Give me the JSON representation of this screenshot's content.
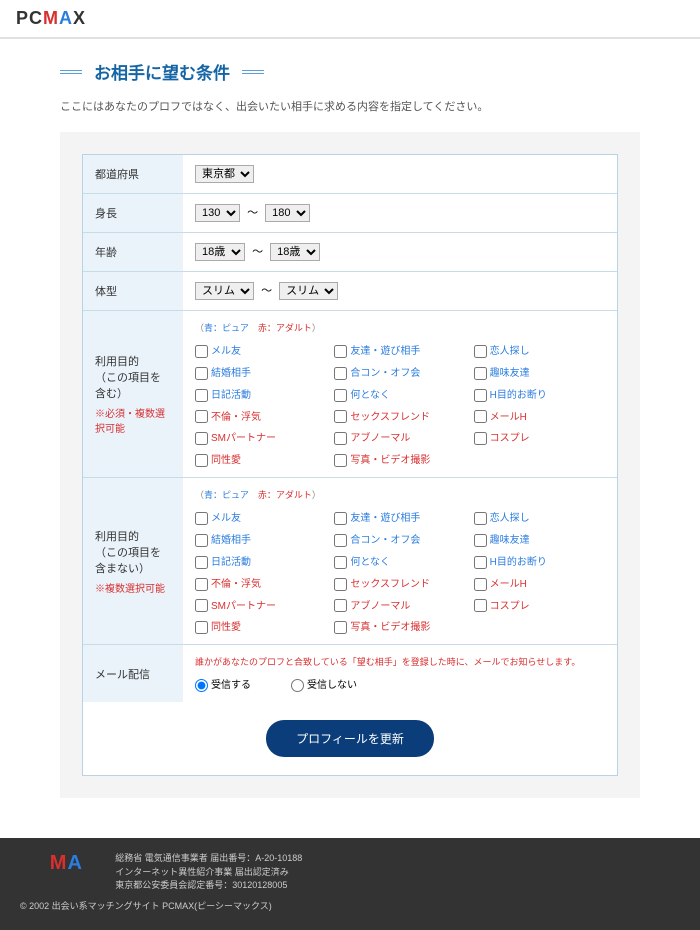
{
  "logo": {
    "p": "P",
    "c": "C",
    "m": "M",
    "a": "A",
    "x": "X"
  },
  "title": "お相手に望む条件",
  "subtitle": "ここにはあなたのプロフではなく、出会いたい相手に求める内容を指定してください。",
  "rows": {
    "prefecture": {
      "label": "都道府県",
      "value": "東京都"
    },
    "height": {
      "label": "身長",
      "from": "130",
      "to": "180",
      "sep": "～"
    },
    "age": {
      "label": "年齢",
      "from": "18歳",
      "to": "18歳",
      "sep": "～"
    },
    "body": {
      "label": "体型",
      "from": "スリム",
      "to": "スリム",
      "sep": "～"
    }
  },
  "legend": {
    "blueLabel": "青：ピュア",
    "redLabel": "赤：アダルト",
    "open": "（",
    "close": "）",
    "mid": "　"
  },
  "purpose_include": {
    "label": "利用目的\n（この項目を含む）",
    "req": "※必須・複数選択可能"
  },
  "purpose_exclude": {
    "label": "利用目的\n（この項目を含まない）",
    "req": "※複数選択可能"
  },
  "options": [
    {
      "t": "メル友",
      "c": "blue"
    },
    {
      "t": "友達・遊び相手",
      "c": "blue"
    },
    {
      "t": "恋人探し",
      "c": "blue"
    },
    {
      "t": "結婚相手",
      "c": "blue"
    },
    {
      "t": "合コン・オフ会",
      "c": "blue"
    },
    {
      "t": "趣味友達",
      "c": "blue"
    },
    {
      "t": "日記活動",
      "c": "blue"
    },
    {
      "t": "何となく",
      "c": "blue"
    },
    {
      "t": "H目的お断り",
      "c": "blue"
    },
    {
      "t": "不倫・浮気",
      "c": "red"
    },
    {
      "t": "セックスフレンド",
      "c": "red"
    },
    {
      "t": "メールH",
      "c": "red"
    },
    {
      "t": "SMパートナー",
      "c": "red"
    },
    {
      "t": "アブノーマル",
      "c": "red"
    },
    {
      "t": "コスプレ",
      "c": "red"
    },
    {
      "t": "同性愛",
      "c": "red"
    },
    {
      "t": "写真・ビデオ撮影",
      "c": "red"
    }
  ],
  "mail": {
    "label": "メール配信",
    "note": "誰かがあなたのプロフと合致している「望む相手」を登録した時に、メールでお知らせします。",
    "opt1": "受信する",
    "opt2": "受信しない"
  },
  "button": "プロフィールを更新",
  "footer": {
    "line1": "総務省 電気通信事業者 届出番号：A-20-10188",
    "line2": "インターネット異性紹介事業 届出認定済み",
    "line3": "東京都公安委員会認定番号：30120128005",
    "copy": "© 2002 出会い系マッチングサイト PCMAX(ピーシーマックス)"
  }
}
